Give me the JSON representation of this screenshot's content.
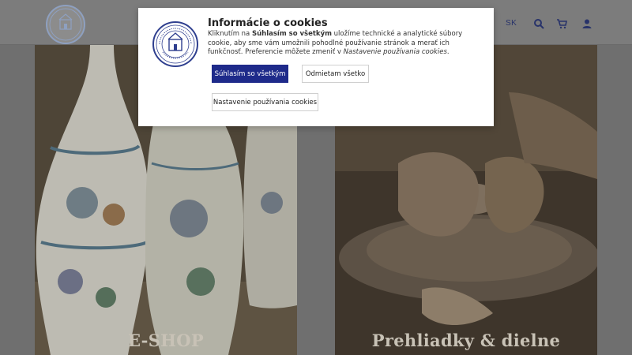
{
  "header": {
    "logo_text": "SLOVENSKÁ ĽUDOVÁ MAJOLIKA",
    "logo_sub": "Since 1883 • MODRA",
    "lang": "SK",
    "icons": [
      "search-icon",
      "cart-icon",
      "user-icon"
    ]
  },
  "tiles": [
    {
      "label": "E-SHOP"
    },
    {
      "label": "Prehliadky & dielne"
    }
  ],
  "cookie": {
    "title": "Informácie o cookies",
    "text_1": "Kliknutím na ",
    "text_bold": "Súhlasím so všetkým",
    "text_2": " uložíme technické a analytické súbory cookie, aby sme vám umožnili pohodlné používanie stránok a merať ich funkčnosť. Preferencie môžete zmeniť v ",
    "text_italic": "Nastavenie používania cookies",
    "text_3": ".",
    "accept_label": "Súhlasím so všetkým",
    "reject_label": "Odmietam všetko",
    "settings_label": "Nastavenie používania cookies"
  },
  "colors": {
    "accent": "#1e2a8a",
    "logo_blue": "#2f3f8f"
  }
}
